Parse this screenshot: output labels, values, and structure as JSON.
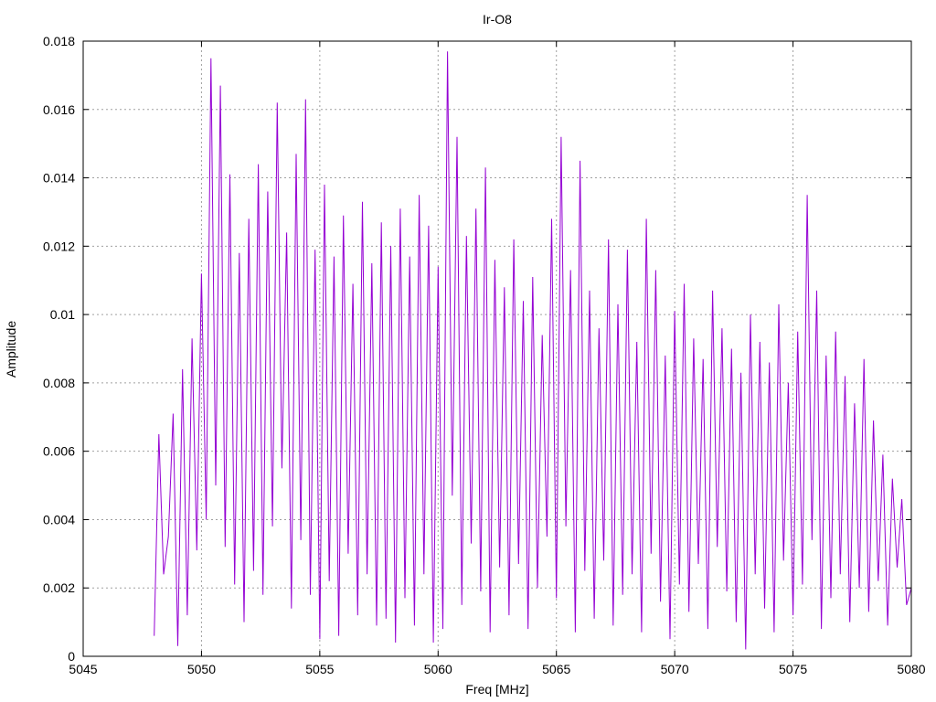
{
  "chart_data": {
    "type": "line",
    "title": "Ir-O8",
    "xlabel": "Freq [MHz]",
    "ylabel": "Amplitude",
    "xlim": [
      5045,
      5080
    ],
    "ylim": [
      0,
      0.018
    ],
    "x_ticks": [
      "5045",
      "5050",
      "5055",
      "5060",
      "5065",
      "5070",
      "5075",
      "5080"
    ],
    "y_ticks": [
      "0",
      "0.002",
      "0.004",
      "0.006",
      "0.008",
      "0.01",
      "0.012",
      "0.014",
      "0.016",
      "0.018"
    ],
    "grid": true,
    "series": [
      {
        "color": "#9400d3",
        "x": [
          5048.0,
          5048.2,
          5048.4,
          5048.6,
          5048.8,
          5049.0,
          5049.2,
          5049.4,
          5049.6,
          5049.8,
          5050.0,
          5050.2,
          5050.4,
          5050.6,
          5050.8,
          5051.0,
          5051.2,
          5051.4,
          5051.6,
          5051.8,
          5052.0,
          5052.2,
          5052.4,
          5052.6,
          5052.8,
          5053.0,
          5053.2,
          5053.4,
          5053.6,
          5053.8,
          5054.0,
          5054.2,
          5054.4,
          5054.6,
          5054.8,
          5055.0,
          5055.2,
          5055.4,
          5055.6,
          5055.8,
          5056.0,
          5056.2,
          5056.4,
          5056.6,
          5056.8,
          5057.0,
          5057.2,
          5057.4,
          5057.6,
          5057.8,
          5058.0,
          5058.2,
          5058.4,
          5058.6,
          5058.8,
          5059.0,
          5059.2,
          5059.4,
          5059.6,
          5059.8,
          5060.0,
          5060.2,
          5060.4,
          5060.6,
          5060.8,
          5061.0,
          5061.2,
          5061.4,
          5061.6,
          5061.8,
          5062.0,
          5062.2,
          5062.4,
          5062.6,
          5062.8,
          5063.0,
          5063.2,
          5063.4,
          5063.6,
          5063.8,
          5064.0,
          5064.2,
          5064.4,
          5064.6,
          5064.8,
          5065.0,
          5065.2,
          5065.4,
          5065.6,
          5065.8,
          5066.0,
          5066.2,
          5066.4,
          5066.6,
          5066.8,
          5067.0,
          5067.2,
          5067.4,
          5067.6,
          5067.8,
          5068.0,
          5068.2,
          5068.4,
          5068.6,
          5068.8,
          5069.0,
          5069.2,
          5069.4,
          5069.6,
          5069.8,
          5070.0,
          5070.2,
          5070.4,
          5070.6,
          5070.8,
          5071.0,
          5071.2,
          5071.4,
          5071.6,
          5071.8,
          5072.0,
          5072.2,
          5072.4,
          5072.6,
          5072.8,
          5073.0,
          5073.2,
          5073.4,
          5073.6,
          5073.8,
          5074.0,
          5074.2,
          5074.4,
          5074.6,
          5074.8,
          5075.0,
          5075.2,
          5075.4,
          5075.6,
          5075.8,
          5076.0,
          5076.2,
          5076.4,
          5076.6,
          5076.8,
          5077.0,
          5077.2,
          5077.4,
          5077.6,
          5077.8,
          5078.0,
          5078.2,
          5078.4,
          5078.6,
          5078.8,
          5079.0,
          5079.2,
          5079.4,
          5079.6,
          5079.8,
          5080.0
        ],
        "y": [
          0.0006,
          0.0065,
          0.0024,
          0.0035,
          0.0071,
          0.0003,
          0.0084,
          0.0012,
          0.0093,
          0.0031,
          0.0112,
          0.004,
          0.0175,
          0.005,
          0.0167,
          0.0032,
          0.0141,
          0.0021,
          0.0118,
          0.001,
          0.0128,
          0.0025,
          0.0144,
          0.0018,
          0.0136,
          0.0038,
          0.0162,
          0.0055,
          0.0124,
          0.0014,
          0.0147,
          0.0034,
          0.0163,
          0.0018,
          0.0119,
          0.0005,
          0.0138,
          0.0022,
          0.0117,
          0.0006,
          0.0129,
          0.003,
          0.0109,
          0.0012,
          0.0133,
          0.0024,
          0.0115,
          0.0009,
          0.0127,
          0.0011,
          0.012,
          0.0004,
          0.0131,
          0.0017,
          0.0117,
          0.0009,
          0.0135,
          0.0024,
          0.0126,
          0.0004,
          0.0114,
          0.0008,
          0.0177,
          0.0047,
          0.0152,
          0.0015,
          0.0123,
          0.0033,
          0.0131,
          0.0019,
          0.0143,
          0.0007,
          0.0116,
          0.0026,
          0.0108,
          0.0012,
          0.0122,
          0.0027,
          0.0104,
          0.0008,
          0.0111,
          0.002,
          0.0094,
          0.0035,
          0.0128,
          0.0017,
          0.0152,
          0.0038,
          0.0113,
          0.0007,
          0.0145,
          0.0025,
          0.0107,
          0.0011,
          0.0096,
          0.0028,
          0.0122,
          0.0009,
          0.0103,
          0.0018,
          0.0119,
          0.0024,
          0.0092,
          0.0007,
          0.0128,
          0.003,
          0.0113,
          0.0016,
          0.0088,
          0.0005,
          0.0101,
          0.0021,
          0.0109,
          0.0013,
          0.0093,
          0.0027,
          0.0087,
          0.0008,
          0.0107,
          0.0032,
          0.0096,
          0.0019,
          0.009,
          0.001,
          0.0083,
          0.0002,
          0.01,
          0.0024,
          0.0092,
          0.0014,
          0.0086,
          0.0007,
          0.0103,
          0.0028,
          0.008,
          0.0012,
          0.0095,
          0.0021,
          0.0135,
          0.0034,
          0.0107,
          0.0008,
          0.0088,
          0.0017,
          0.0095,
          0.0024,
          0.0082,
          0.001,
          0.0074,
          0.002,
          0.0087,
          0.0013,
          0.0069,
          0.0022,
          0.0059,
          0.0009,
          0.0052,
          0.0026,
          0.0046,
          0.0015,
          0.002
        ]
      }
    ]
  }
}
